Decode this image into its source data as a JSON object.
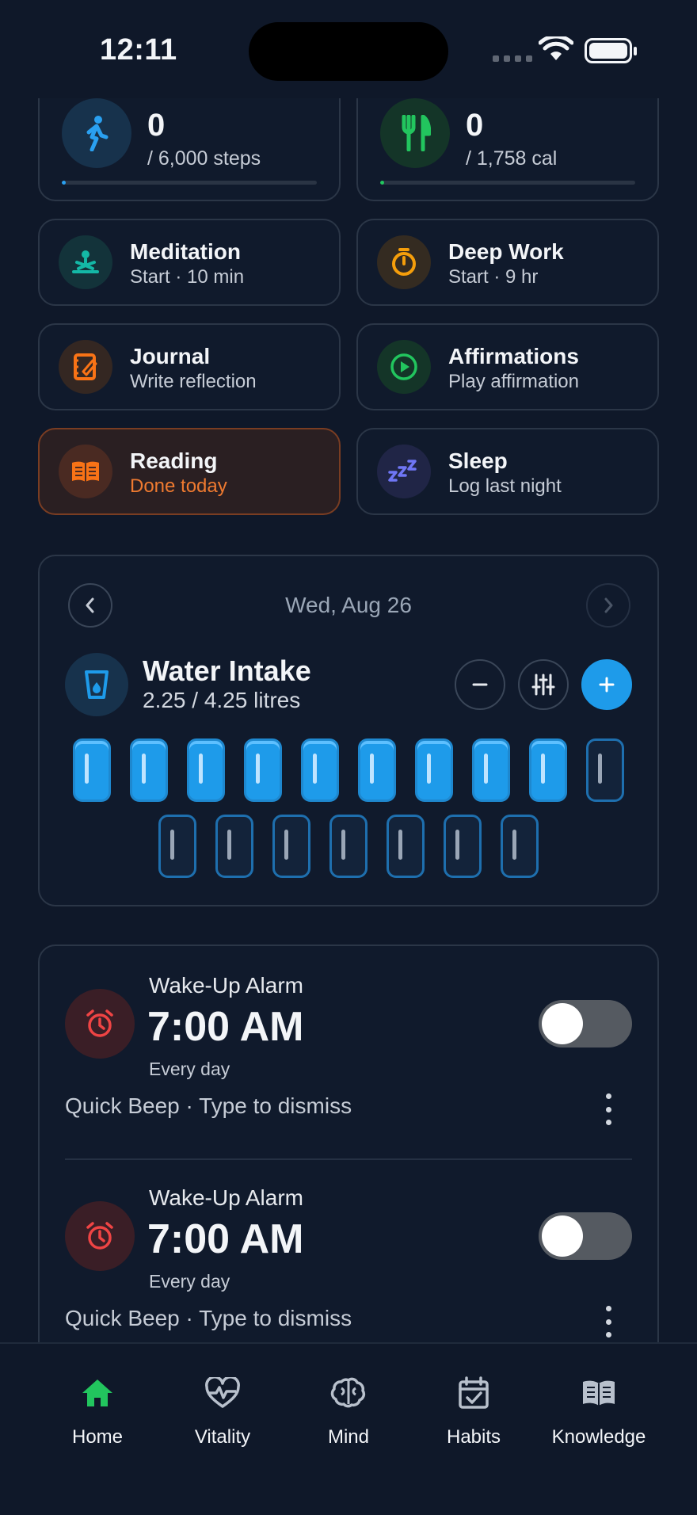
{
  "status_bar": {
    "time": "12:11"
  },
  "stats": [
    {
      "name": "steps",
      "value": "0",
      "goal": "/ 6,000 steps",
      "progress": 0.0,
      "color": "#2aa0f0",
      "icon": "walking-icon"
    },
    {
      "name": "calories",
      "value": "0",
      "goal": "/ 1,758 cal",
      "progress": 0.0,
      "color": "#22c55e",
      "icon": "fork-knife-icon"
    }
  ],
  "tiles": [
    {
      "title": "Meditation",
      "subtitle": "Start · 10 min",
      "icon": "meditation-icon",
      "color": "#14b8a6"
    },
    {
      "title": "Deep Work",
      "subtitle": "Start · 9 hr",
      "icon": "stopwatch-icon",
      "color": "#f59e0b"
    },
    {
      "title": "Journal",
      "subtitle": "Write reflection",
      "icon": "journal-icon",
      "color": "#f97316"
    },
    {
      "title": "Affirmations",
      "subtitle": "Play affirmation",
      "icon": "play-circle-icon",
      "color": "#22c55e"
    },
    {
      "title": "Reading",
      "subtitle": "Done today",
      "icon": "open-book-icon",
      "color": "#f97316",
      "done": true
    },
    {
      "title": "Sleep",
      "subtitle": "Log last night",
      "icon": "zzz-icon",
      "color": "#6366f1"
    }
  ],
  "water": {
    "date": "Wed, Aug 26",
    "title": "Water Intake",
    "amount": "2.25 / 4.25 litres",
    "glasses_filled": 9,
    "glasses_total": 17,
    "accent": "#1e9bea"
  },
  "alarms": [
    {
      "name": "Wake-Up Alarm",
      "time": "7:00 AM",
      "repeat": "Every day",
      "description": "Quick Beep · Type to dismiss",
      "enabled": false
    },
    {
      "name": "Wake-Up Alarm",
      "time": "7:00 AM",
      "repeat": "Every day",
      "description": "Quick Beep · Type to dismiss",
      "enabled": false
    }
  ],
  "tabs": [
    {
      "label": "Home",
      "icon": "home-icon",
      "active": true
    },
    {
      "label": "Vitality",
      "icon": "heart-pulse-icon",
      "active": false
    },
    {
      "label": "Mind",
      "icon": "brain-icon",
      "active": false
    },
    {
      "label": "Habits",
      "icon": "calendar-check-icon",
      "active": false
    },
    {
      "label": "Knowledge",
      "icon": "book-icon",
      "active": false
    }
  ],
  "colors": {
    "background": "#0f1829",
    "active_tab": "#22c55e",
    "alarm": "#ef4444"
  }
}
